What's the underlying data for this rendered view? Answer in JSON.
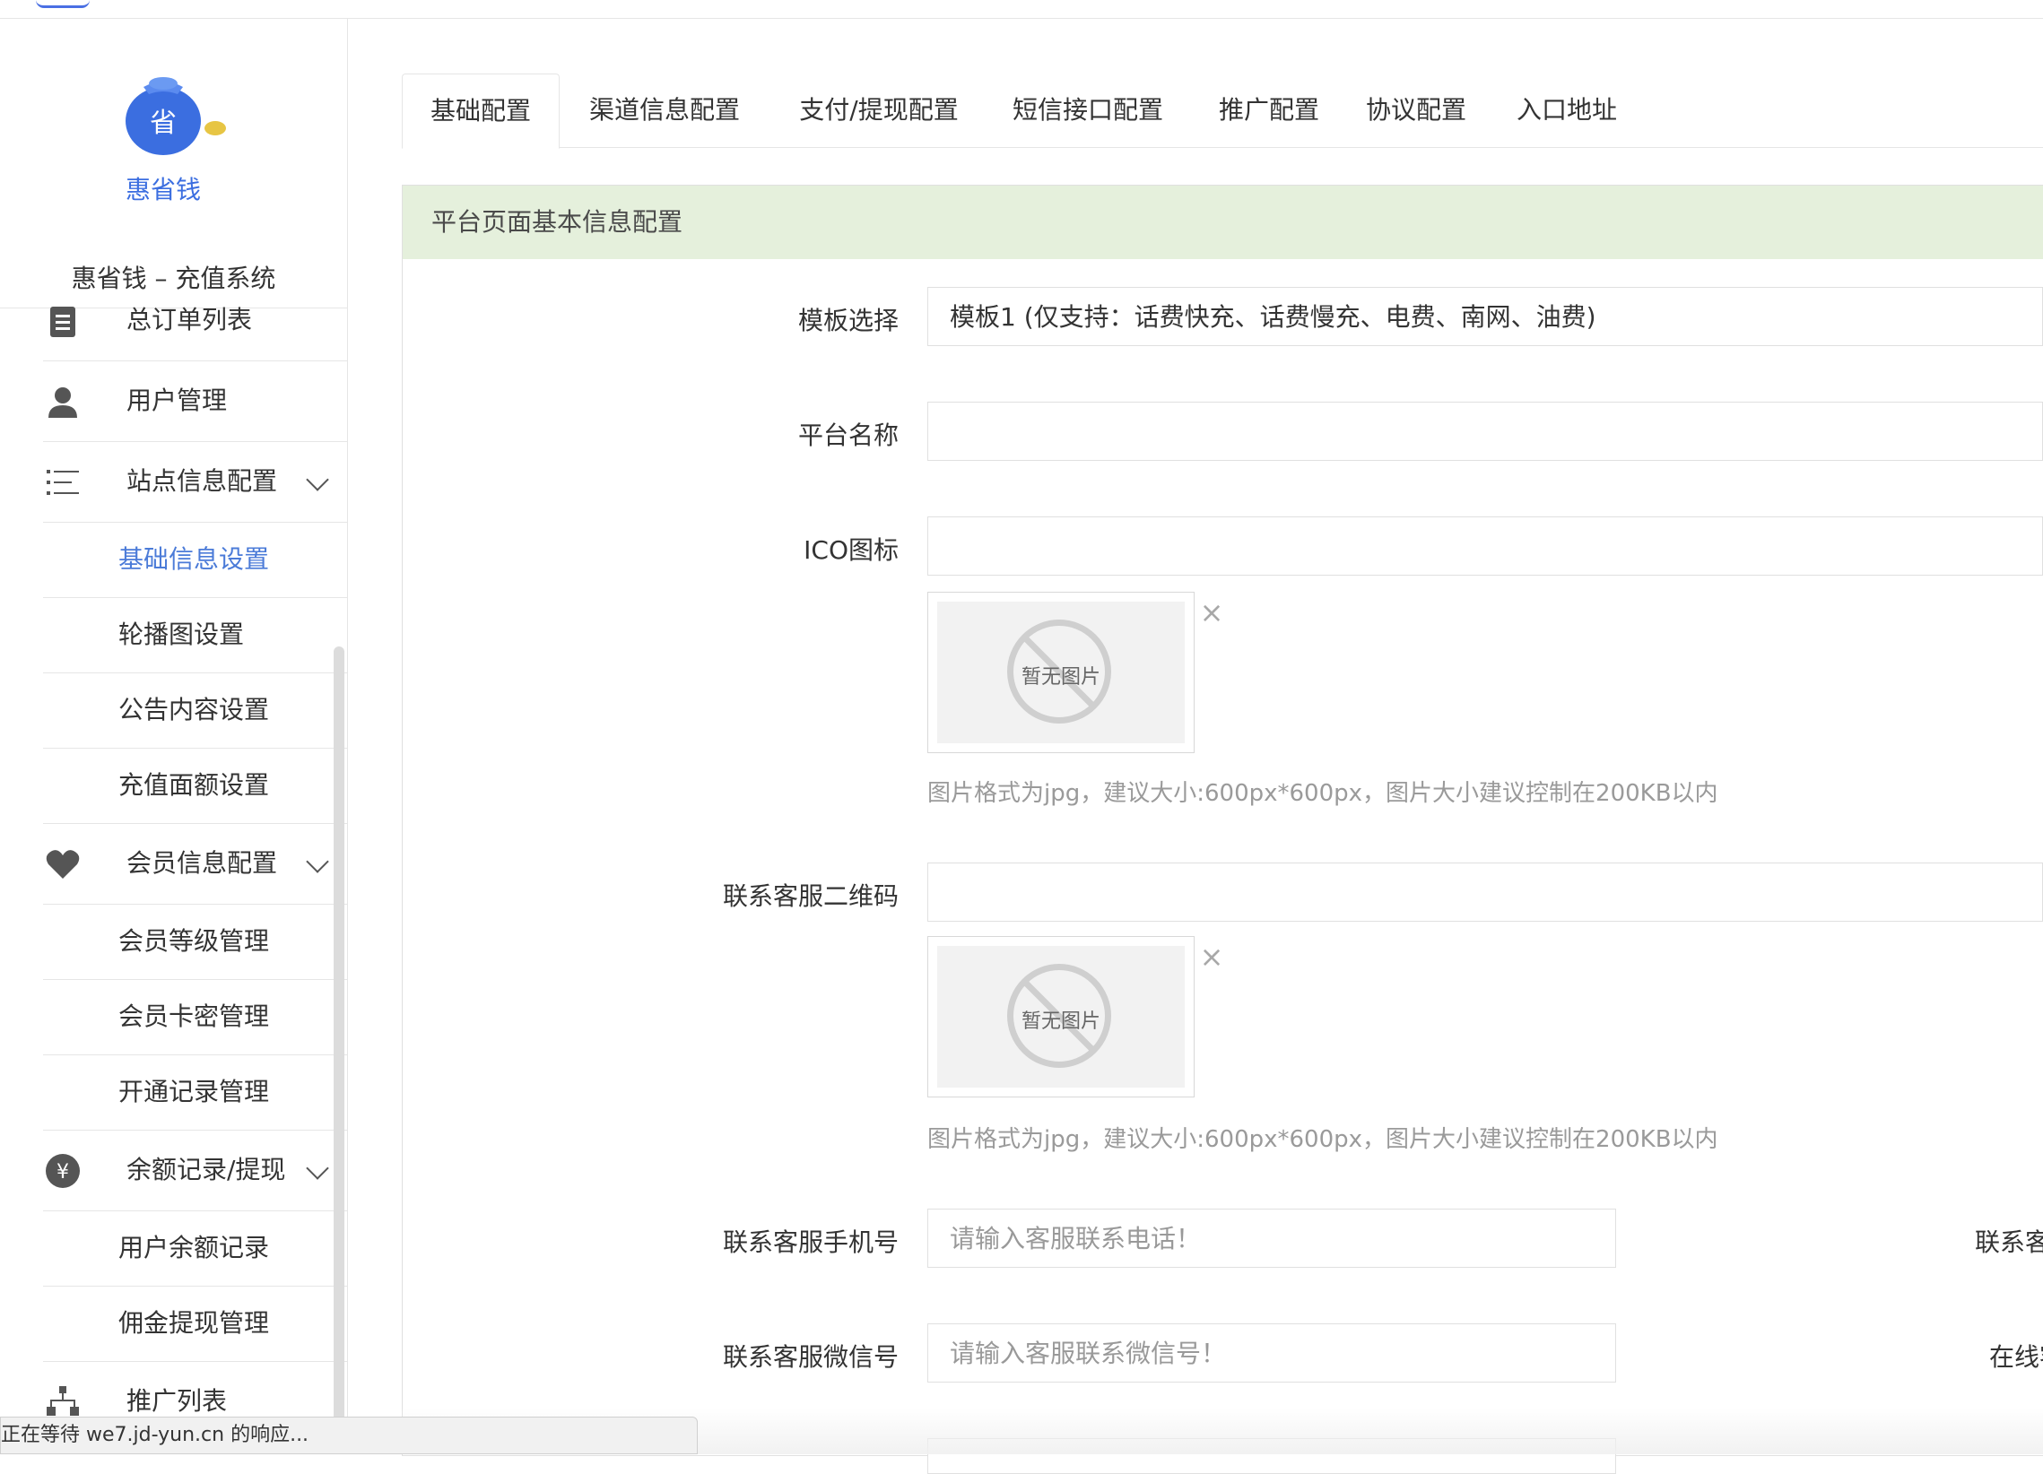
{
  "sidebar": {
    "system_name": "惠省钱 – 充值系统",
    "logo_text": "惠省钱",
    "logo_badge": "省",
    "menu": [
      {
        "label": "总订单列表",
        "icon": "list-icon"
      },
      {
        "label": "用户管理",
        "icon": "user-icon"
      },
      {
        "label": "站点信息配置",
        "icon": "menu-lines-icon",
        "expanded": true
      },
      {
        "label": "会员信息配置",
        "icon": "heart-icon",
        "expanded": true
      },
      {
        "label": "余额记录/提现",
        "icon": "yen-icon",
        "expanded": true
      },
      {
        "label": "推广列表",
        "icon": "org-chart-icon"
      }
    ],
    "submenu_site": [
      "基础信息设置",
      "轮播图设置",
      "公告内容设置",
      "充值面额设置"
    ],
    "submenu_member": [
      "会员等级管理",
      "会员卡密管理",
      "开通记录管理"
    ],
    "submenu_balance": [
      "用户余额记录",
      "佣金提现管理"
    ],
    "yen_symbol": "¥"
  },
  "tabs": [
    "基础配置",
    "渠道信息配置",
    "支付/提现配置",
    "短信接口配置",
    "推广配置",
    "协议配置",
    "入口地址"
  ],
  "panel": {
    "title": "平台页面基本信息配置",
    "template_label": "模板选择",
    "template_value": "模板1 (仅支持：话费快充、话费慢充、电费、南网、油费)",
    "platform_name_label": "平台名称",
    "platform_name_value": "",
    "ico_label": "ICO图标",
    "ico_value": "",
    "no_image_text": "暂无图片",
    "image_hint": "图片格式为jpg，建议大小:600px*600px，图片大小建议控制在200KB以内",
    "qr_label": "联系客服二维码",
    "qr_value": "",
    "phone_label": "联系客服手机号",
    "phone_placeholder": "请输入客服联系电话！",
    "phone_right_label": "联系客",
    "wechat_label": "联系客服微信号",
    "wechat_placeholder": "请输入客服联系微信号！",
    "wechat_right_label": "在线客",
    "close_symbol": "×"
  },
  "statusbar": {
    "text": "正在等待 we7.jd-yun.cn 的响应..."
  },
  "colors": {
    "active_menu": "#4b7bd8",
    "panel_header_bg": "#e5f0dc",
    "logo_blue": "#3b6ee0",
    "logo_gold": "#e7c544"
  }
}
